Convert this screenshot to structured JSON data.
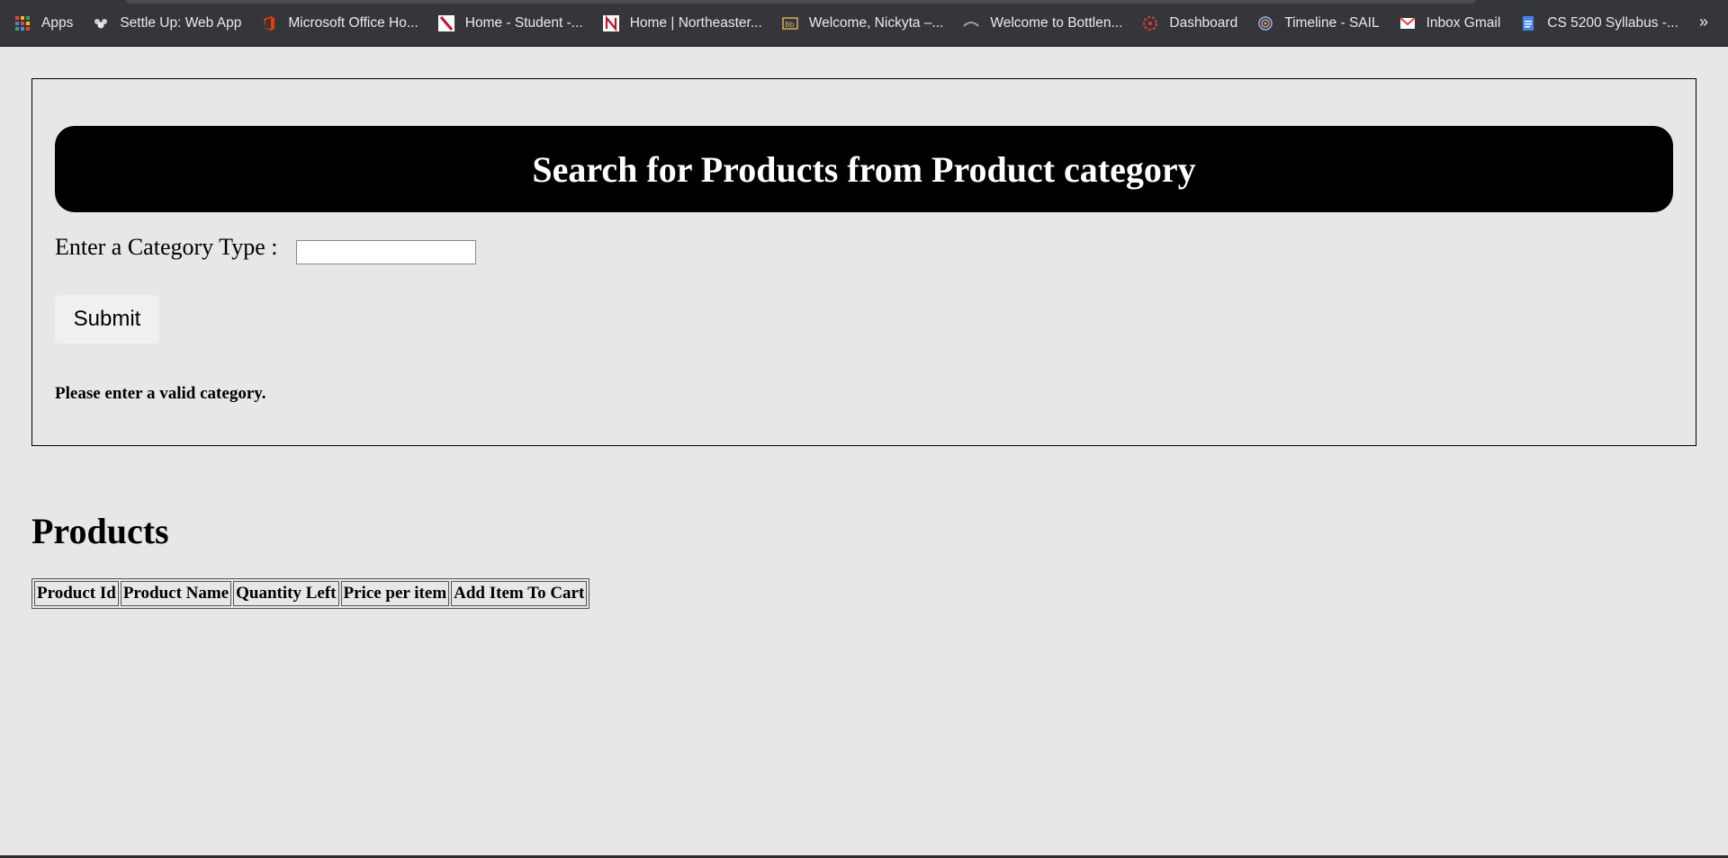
{
  "bookmarks": [
    {
      "label": "Apps",
      "icon": "apps-grid-icon"
    },
    {
      "label": "Settle Up: Web App",
      "icon": "people-icon"
    },
    {
      "label": "Microsoft Office Ho...",
      "icon": "office-icon"
    },
    {
      "label": "Home - Student -...",
      "icon": "northeastern-icon"
    },
    {
      "label": "Home | Northeaster...",
      "icon": "northeastern-n-icon"
    },
    {
      "label": "Welcome, Nickyta –...",
      "icon": "blackboard-icon"
    },
    {
      "label": "Welcome to Bottlen...",
      "icon": "bottleneck-icon"
    },
    {
      "label": "Dashboard",
      "icon": "canvas-icon"
    },
    {
      "label": "Timeline - SAIL",
      "icon": "sail-icon"
    },
    {
      "label": "Inbox  Gmail",
      "icon": "gmail-icon"
    },
    {
      "label": "CS 5200 Syllabus -...",
      "icon": "docs-icon"
    }
  ],
  "more_label": "»",
  "search": {
    "title": "Search for Products from Product category",
    "category_label": "Enter a Category Type :",
    "category_value": "",
    "submit_label": "Submit",
    "error_message": "Please enter a valid category."
  },
  "products": {
    "heading": "Products",
    "columns": [
      "Product Id",
      "Product Name",
      "Quantity Left",
      "Price per item",
      "Add Item To Cart"
    ],
    "rows": []
  },
  "colors": {
    "page_background": "#e8e6e7",
    "banner_background": "#000000",
    "banner_text": "#ffffff",
    "bookmarks_bar": "#35363a"
  }
}
